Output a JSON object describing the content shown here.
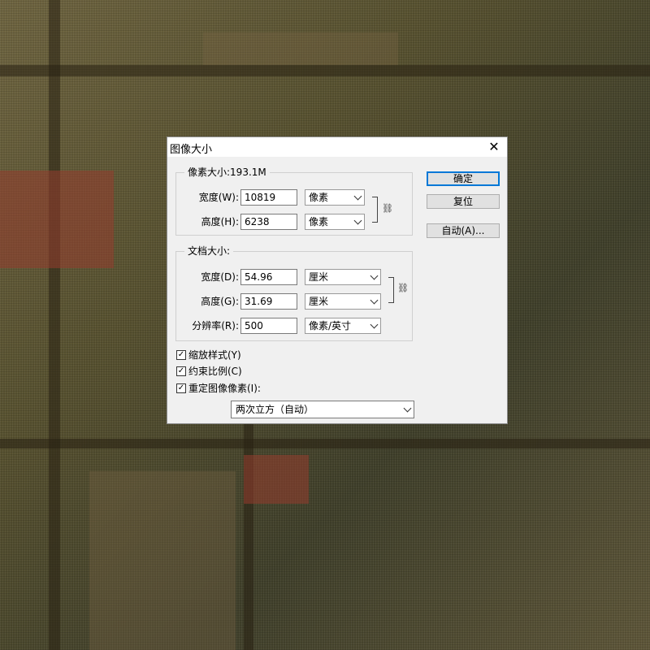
{
  "dialog": {
    "title": "图像大小",
    "close_glyph": "✕",
    "pixel_dimensions": {
      "legend": "像素大小:193.1M",
      "width_label": "宽度(W):",
      "width_value": "10819",
      "width_unit": "像素",
      "height_label": "高度(H):",
      "height_value": "6238",
      "height_unit": "像素",
      "link_icon": "link-icon"
    },
    "document_size": {
      "legend": "文档大小:",
      "width_label": "宽度(D):",
      "width_value": "54.96",
      "width_unit": "厘米",
      "height_label": "高度(G):",
      "height_value": "31.69",
      "height_unit": "厘米",
      "resolution_label": "分辨率(R):",
      "resolution_value": "500",
      "resolution_unit": "像素/英寸",
      "link_icon": "link-icon"
    },
    "checkboxes": [
      {
        "label": "缩放样式(Y)",
        "checked": true
      },
      {
        "label": "约束比例(C)",
        "checked": true
      },
      {
        "label": "重定图像像素(I):",
        "checked": true
      }
    ],
    "resample_method": "两次立方（自动）",
    "buttons": {
      "ok": "确定",
      "reset": "复位",
      "auto": "自动(A)..."
    },
    "accent_color": "#0078d7"
  }
}
